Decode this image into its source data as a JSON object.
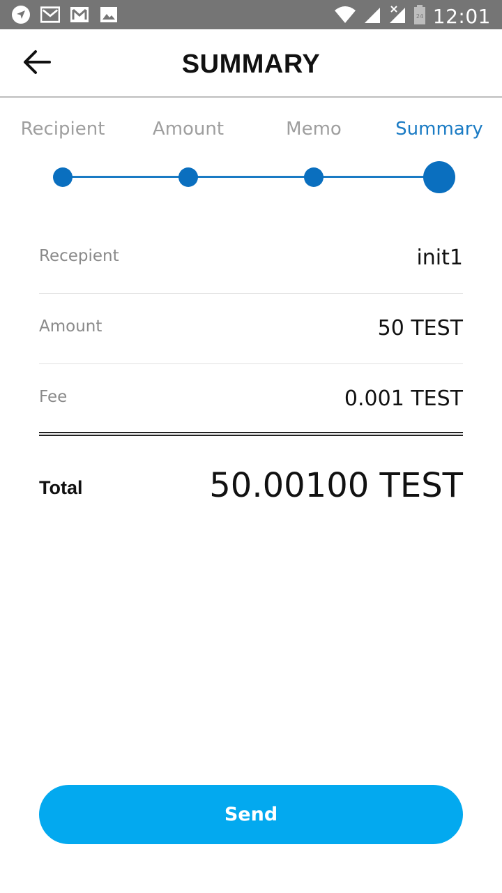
{
  "status_bar": {
    "time": "12:01",
    "icons_left": [
      "navigation-icon",
      "gmail-icon",
      "gmail-icon",
      "image-icon"
    ],
    "icons_right": [
      "wifi-icon",
      "signal-icon",
      "signal-no-data-icon",
      "battery-icon"
    ]
  },
  "header": {
    "title": "SUMMARY",
    "back_icon": "arrow-left-icon"
  },
  "steps": {
    "items": [
      {
        "label": "Recipient",
        "active": false
      },
      {
        "label": "Amount",
        "active": false
      },
      {
        "label": "Memo",
        "active": false
      },
      {
        "label": "Summary",
        "active": true
      }
    ],
    "color": "#1a7bc4"
  },
  "summary": {
    "rows": [
      {
        "label": "Recepient",
        "value": "init1"
      },
      {
        "label": "Amount",
        "value": "50 TEST"
      },
      {
        "label": "Fee",
        "value": "0.001 TEST"
      }
    ],
    "total_label": "Total",
    "total_value": "50.00100 TEST"
  },
  "actions": {
    "send_label": "Send",
    "send_color": "#03a9ef"
  }
}
